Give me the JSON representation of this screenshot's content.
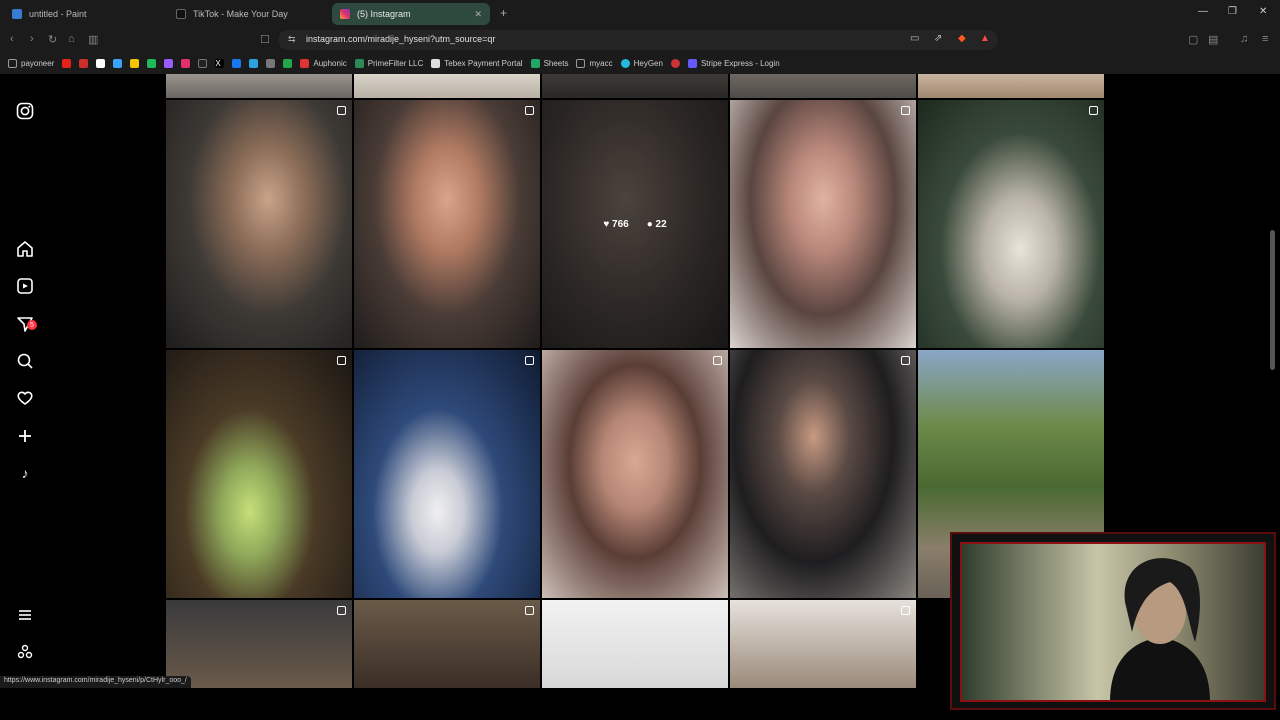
{
  "tabs": [
    {
      "title": "untitled - Paint",
      "active": false
    },
    {
      "title": "TikTok - Make Your Day",
      "active": false
    },
    {
      "title": "(5) Instagram",
      "active": true
    }
  ],
  "new_tab_label": "+",
  "url": "instagram.com/miradije_hyseni?utm_source=qr",
  "bookmarks": [
    "payoneer",
    "Auphonic",
    "PrimeFilter LLC",
    "Tebex Payment Portal",
    "Sheets",
    "myacc",
    "HeyGen",
    "Stripe Express - Login"
  ],
  "sidebar": {
    "icons": [
      "instagram-logo-icon",
      "home-icon",
      "reels-icon",
      "direct-messages-icon",
      "search-icon",
      "notifications-heart-icon",
      "create-plus-icon",
      "threads-icon",
      "more-menu-icon",
      "meta-icon"
    ],
    "messages_badge": "5"
  },
  "hover_post": {
    "likes": "766",
    "comments": "22"
  },
  "status_url": "https://www.instagram.com/miradije_hyseni/p/CtHylr_ooo_/",
  "colors": {
    "accent_tab": "#2e4a3f",
    "badge": "#ff3040",
    "cam_border": "#8a1111"
  }
}
